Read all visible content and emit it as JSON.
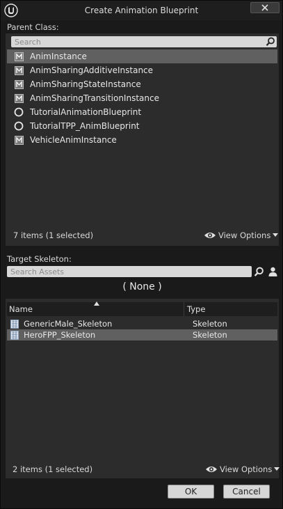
{
  "window": {
    "title": "Create Animation Blueprint",
    "close_glyph": "✕",
    "logo_icon": "unreal-logo-icon"
  },
  "parent_class": {
    "label": "Parent Class:",
    "search": {
      "placeholder": "Search",
      "value": ""
    },
    "items": [
      {
        "label": "AnimInstance",
        "icon": "class-icon",
        "selected": true
      },
      {
        "label": "AnimSharingAdditiveInstance",
        "icon": "class-icon",
        "selected": false
      },
      {
        "label": "AnimSharingStateInstance",
        "icon": "class-icon",
        "selected": false
      },
      {
        "label": "AnimSharingTransitionInstance",
        "icon": "class-icon",
        "selected": false
      },
      {
        "label": "TutorialAnimationBlueprint",
        "icon": "circle-icon",
        "selected": false
      },
      {
        "label": "TutorialTPP_AnimBlueprint",
        "icon": "circle-icon",
        "selected": false
      },
      {
        "label": "VehicleAnimInstance",
        "icon": "class-icon",
        "selected": false
      }
    ],
    "status": "7 items (1 selected)",
    "view_options": "View Options"
  },
  "target_skeleton": {
    "label": "Target Skeleton:",
    "search": {
      "placeholder": "Search Assets",
      "value": ""
    },
    "current": "( None )",
    "columns": {
      "name": "Name",
      "type": "Type"
    },
    "rows": [
      {
        "name": "GenericMale_Skeleton",
        "type": "Skeleton",
        "selected": false
      },
      {
        "name": "HeroFPP_Skeleton",
        "type": "Skeleton",
        "selected": true
      }
    ],
    "status": "2 items (1 selected)",
    "view_options": "View Options"
  },
  "buttons": {
    "ok": "OK",
    "cancel": "Cancel"
  },
  "colors": {
    "selection": "#606060",
    "panel": "#2c2c2c",
    "background": "#1a1a1a"
  }
}
